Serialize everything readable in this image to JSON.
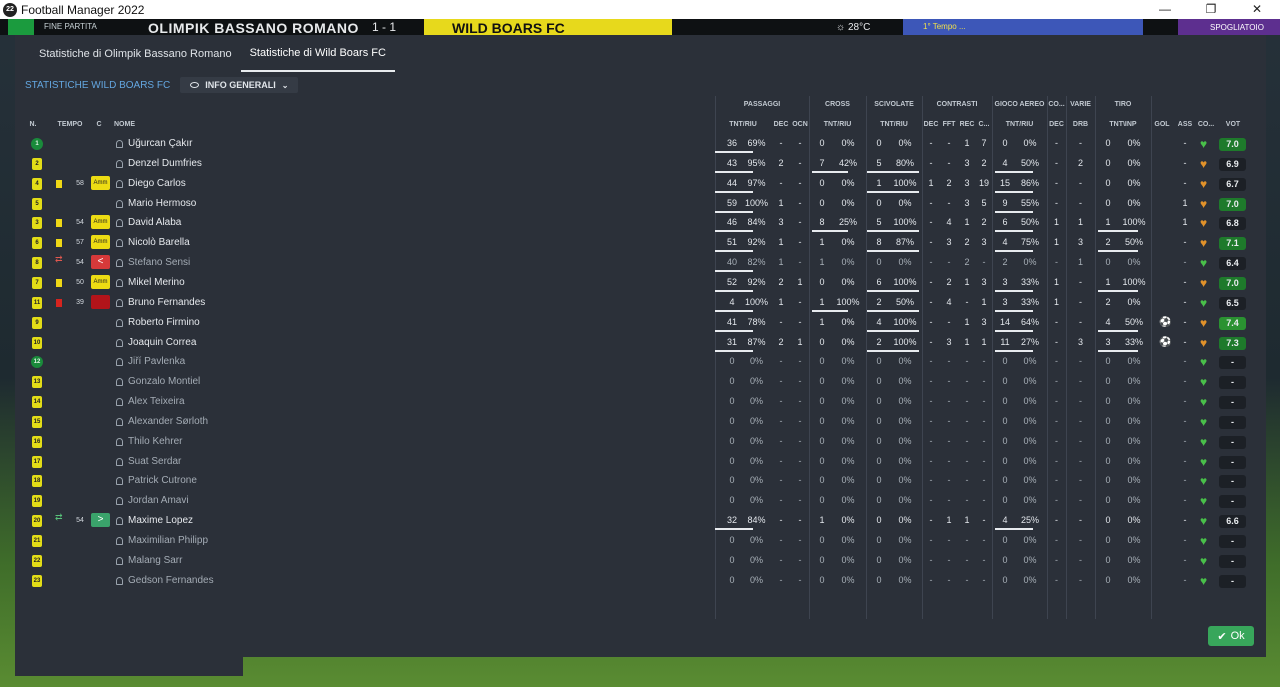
{
  "window": {
    "title": "Football Manager 2022",
    "app_badge": "22",
    "minimize": "—",
    "maximize": "❐",
    "close": "✕"
  },
  "topbar": {
    "status": "FINE PARTITA",
    "home_team": "OLIMPIK BASSANO ROMANO",
    "score": "1 - 1",
    "away_team": "WILD BOARS FC",
    "weather": "☼ 28°C",
    "sponsor": "1° Tempo ...",
    "continue": "SPOGLIATOIO"
  },
  "tabs": [
    {
      "label": "Statistiche di Olimpik Bassano Romano",
      "active": false
    },
    {
      "label": "Statistiche di Wild Boars FC",
      "active": true
    }
  ],
  "subheader": {
    "title": "STATISTICHE WILD BOARS FC",
    "dropdown": "INFO GENERALI"
  },
  "group_headers": {
    "passaggi": "PASSAGGI",
    "cross": "CROSS",
    "scivolate": "SCIVOLATE",
    "contrasti": "CONTRASTI",
    "gioco_aereo": "GIOCO AEREO",
    "co": "CO...",
    "varie": "VARIE",
    "tiro": "TIRO"
  },
  "columns": {
    "num": "N.",
    "tempo": "TEMPO",
    "c": "C",
    "nome": "NOME",
    "tnt_riu": "TNT/RIU",
    "dec": "DEC",
    "ocn": "OCN",
    "cross_tnt": "TNT/RIU",
    "sciv_tnt": "TNT/RIU",
    "c_dec": "DEC",
    "fft": "FFT",
    "rec": "REC",
    "c_more": "C...",
    "aereo_tnt": "TNT/RIU",
    "co_dec": "DEC",
    "drb": "DRB",
    "tiro_tnt": "TNT\\INP",
    "gol": "GOL",
    "ass": "ASS",
    "cond": "CO...",
    "vot": "VOT"
  },
  "players": [
    {
      "num": "1",
      "gk": true,
      "name": "Uğurcan Çakır",
      "pass": "36",
      "pass_pct": "69%",
      "dec": "-",
      "ocn": "-",
      "cross": "0",
      "cross_pct": "0%",
      "sciv": "0",
      "sciv_pct": "0%",
      "c_dec": "-",
      "fft": "-",
      "rec": "1",
      "cc": "7",
      "aer": "0",
      "aer_pct": "0%",
      "co_dec": "-",
      "drb": "-",
      "tiro": "0",
      "tiro_pct": "0%",
      "ass": "-",
      "vot": "7.0",
      "vot_style": "good",
      "heart": "green",
      "pass_ul": true
    },
    {
      "num": "2",
      "name": "Denzel Dumfries",
      "pass": "43",
      "pass_pct": "95%",
      "dec": "2",
      "ocn": "-",
      "cross": "7",
      "cross_pct": "42%",
      "sciv": "5",
      "sciv_pct": "80%",
      "c_dec": "-",
      "fft": "-",
      "rec": "3",
      "cc": "2",
      "aer": "4",
      "aer_pct": "50%",
      "co_dec": "-",
      "drb": "2",
      "tiro": "0",
      "tiro_pct": "0%",
      "ass": "-",
      "vot": "6.9",
      "heart": "orange",
      "pass_ul": true,
      "cross_ul": true,
      "sciv_ul": true,
      "aer_ul": true
    },
    {
      "num": "4",
      "tempo": "58",
      "card": "yellow",
      "cbadge": "Amm",
      "name": "Diego Carlos",
      "pass": "44",
      "pass_pct": "97%",
      "dec": "-",
      "ocn": "-",
      "cross": "0",
      "cross_pct": "0%",
      "sciv": "1",
      "sciv_pct": "100%",
      "c_dec": "1",
      "fft": "2",
      "rec": "3",
      "cc": "19",
      "aer": "15",
      "aer_pct": "86%",
      "co_dec": "-",
      "drb": "-",
      "tiro": "0",
      "tiro_pct": "0%",
      "ass": "-",
      "vot": "6.7",
      "heart": "orange",
      "pass_ul": true,
      "sciv_ul": true,
      "aer_ul": true
    },
    {
      "num": "5",
      "name": "Mario Hermoso",
      "pass": "59",
      "pass_pct": "100%",
      "dec": "1",
      "ocn": "-",
      "cross": "0",
      "cross_pct": "0%",
      "sciv": "0",
      "sciv_pct": "0%",
      "c_dec": "-",
      "fft": "-",
      "rec": "3",
      "cc": "5",
      "aer": "9",
      "aer_pct": "55%",
      "co_dec": "-",
      "drb": "-",
      "tiro": "0",
      "tiro_pct": "0%",
      "ass": "1",
      "vot": "7.0",
      "vot_style": "good",
      "heart": "orange",
      "pass_ul": true,
      "aer_ul": true
    },
    {
      "num": "3",
      "tempo": "54",
      "card": "yellow",
      "cbadge": "Amm",
      "name": "David Alaba",
      "pass": "46",
      "pass_pct": "84%",
      "dec": "3",
      "ocn": "-",
      "cross": "8",
      "cross_pct": "25%",
      "sciv": "5",
      "sciv_pct": "100%",
      "c_dec": "-",
      "fft": "4",
      "rec": "1",
      "cc": "2",
      "aer": "6",
      "aer_pct": "50%",
      "co_dec": "1",
      "drb": "1",
      "tiro": "1",
      "tiro_pct": "100%",
      "ass": "1",
      "vot": "6.8",
      "heart": "orange",
      "pass_ul": true,
      "cross_ul": true,
      "sciv_ul": true,
      "aer_ul": true,
      "tiro_ul": true
    },
    {
      "num": "6",
      "tempo": "57",
      "card": "yellow",
      "cbadge": "Amm",
      "name": "Nicolò Barella",
      "pass": "51",
      "pass_pct": "92%",
      "dec": "1",
      "ocn": "-",
      "cross": "1",
      "cross_pct": "0%",
      "sciv": "8",
      "sciv_pct": "87%",
      "c_dec": "-",
      "fft": "3",
      "rec": "2",
      "cc": "3",
      "aer": "4",
      "aer_pct": "75%",
      "co_dec": "1",
      "drb": "3",
      "tiro": "2",
      "tiro_pct": "50%",
      "ass": "-",
      "vot": "7.1",
      "vot_style": "good",
      "heart": "orange",
      "pass_ul": true,
      "sciv_ul": true,
      "aer_ul": true,
      "tiro_ul": true
    },
    {
      "num": "8",
      "tempo": "54",
      "sub": "out",
      "cbadge_type": "out",
      "cbadge_glyph": "<",
      "dim": true,
      "name": "Stefano Sensi",
      "pass": "40",
      "pass_pct": "82%",
      "dec": "1",
      "ocn": "-",
      "cross": "1",
      "cross_pct": "0%",
      "sciv": "0",
      "sciv_pct": "0%",
      "c_dec": "-",
      "fft": "-",
      "rec": "2",
      "cc": "-",
      "aer": "2",
      "aer_pct": "0%",
      "co_dec": "-",
      "drb": "1",
      "tiro": "0",
      "tiro_pct": "0%",
      "ass": "-",
      "vot": "6.4",
      "heart": "green",
      "pass_ul": true
    },
    {
      "num": "7",
      "tempo": "50",
      "card": "yellow",
      "cbadge": "Amm",
      "name": "Mikel Merino",
      "pass": "52",
      "pass_pct": "92%",
      "dec": "2",
      "ocn": "1",
      "cross": "0",
      "cross_pct": "0%",
      "sciv": "6",
      "sciv_pct": "100%",
      "c_dec": "-",
      "fft": "2",
      "rec": "1",
      "cc": "3",
      "aer": "3",
      "aer_pct": "33%",
      "co_dec": "1",
      "drb": "-",
      "tiro": "1",
      "tiro_pct": "100%",
      "ass": "-",
      "vot": "7.0",
      "vot_style": "good",
      "heart": "orange",
      "pass_ul": true,
      "sciv_ul": true,
      "aer_ul": true,
      "tiro_ul": true
    },
    {
      "num": "11",
      "tempo": "39",
      "card": "red",
      "cbadge_type": "esp",
      "name": "Bruno Fernandes",
      "pass": "4",
      "pass_pct": "100%",
      "dec": "1",
      "ocn": "-",
      "cross": "1",
      "cross_pct": "100%",
      "sciv": "2",
      "sciv_pct": "50%",
      "c_dec": "-",
      "fft": "4",
      "rec": "-",
      "cc": "1",
      "aer": "3",
      "aer_pct": "33%",
      "co_dec": "1",
      "drb": "-",
      "tiro": "2",
      "tiro_pct": "0%",
      "ass": "-",
      "vot": "6.5",
      "heart": "green",
      "pass_ul": true,
      "cross_ul": true,
      "sciv_ul": true,
      "aer_ul": true
    },
    {
      "num": "9",
      "name": "Roberto Firmino",
      "pass": "41",
      "pass_pct": "78%",
      "dec": "-",
      "ocn": "-",
      "cross": "1",
      "cross_pct": "0%",
      "sciv": "4",
      "sciv_pct": "100%",
      "c_dec": "-",
      "fft": "-",
      "rec": "1",
      "cc": "3",
      "aer": "14",
      "aer_pct": "64%",
      "co_dec": "-",
      "drb": "-",
      "tiro": "4",
      "tiro_pct": "50%",
      "gol": "⚽",
      "ass": "-",
      "vot": "7.4",
      "vot_style": "green",
      "heart": "orange",
      "pass_ul": true,
      "sciv_ul": true,
      "aer_ul": true,
      "tiro_ul": true
    },
    {
      "num": "10",
      "name": "Joaquin Correa",
      "pass": "31",
      "pass_pct": "87%",
      "dec": "2",
      "ocn": "1",
      "cross": "0",
      "cross_pct": "0%",
      "sciv": "2",
      "sciv_pct": "100%",
      "c_dec": "-",
      "fft": "3",
      "rec": "1",
      "cc": "1",
      "aer": "11",
      "aer_pct": "27%",
      "co_dec": "-",
      "drb": "3",
      "tiro": "3",
      "tiro_pct": "33%",
      "gol": "⚽",
      "ass": "-",
      "vot": "7.3",
      "vot_style": "good",
      "heart": "orange",
      "pass_ul": true,
      "sciv_ul": true,
      "aer_ul": true,
      "tiro_ul": true
    },
    {
      "num": "12",
      "gk": true,
      "dim": true,
      "name": "Jiří Pavlenka",
      "pass": "0",
      "pass_pct": "0%",
      "dec": "-",
      "ocn": "-",
      "cross": "0",
      "cross_pct": "0%",
      "sciv": "0",
      "sciv_pct": "0%",
      "c_dec": "-",
      "fft": "-",
      "rec": "-",
      "cc": "-",
      "aer": "0",
      "aer_pct": "0%",
      "co_dec": "-",
      "drb": "-",
      "tiro": "0",
      "tiro_pct": "0%",
      "ass": "-",
      "vot": "-",
      "heart": "green"
    },
    {
      "num": "13",
      "dim": true,
      "name": "Gonzalo Montiel",
      "pass": "0",
      "pass_pct": "0%",
      "dec": "-",
      "ocn": "-",
      "cross": "0",
      "cross_pct": "0%",
      "sciv": "0",
      "sciv_pct": "0%",
      "c_dec": "-",
      "fft": "-",
      "rec": "-",
      "cc": "-",
      "aer": "0",
      "aer_pct": "0%",
      "co_dec": "-",
      "drb": "-",
      "tiro": "0",
      "tiro_pct": "0%",
      "ass": "-",
      "vot": "-",
      "heart": "green"
    },
    {
      "num": "14",
      "dim": true,
      "name": "Alex Teixeira",
      "pass": "0",
      "pass_pct": "0%",
      "dec": "-",
      "ocn": "-",
      "cross": "0",
      "cross_pct": "0%",
      "sciv": "0",
      "sciv_pct": "0%",
      "c_dec": "-",
      "fft": "-",
      "rec": "-",
      "cc": "-",
      "aer": "0",
      "aer_pct": "0%",
      "co_dec": "-",
      "drb": "-",
      "tiro": "0",
      "tiro_pct": "0%",
      "ass": "-",
      "vot": "-",
      "heart": "green"
    },
    {
      "num": "15",
      "dim": true,
      "name": "Alexander Sørloth",
      "pass": "0",
      "pass_pct": "0%",
      "dec": "-",
      "ocn": "-",
      "cross": "0",
      "cross_pct": "0%",
      "sciv": "0",
      "sciv_pct": "0%",
      "c_dec": "-",
      "fft": "-",
      "rec": "-",
      "cc": "-",
      "aer": "0",
      "aer_pct": "0%",
      "co_dec": "-",
      "drb": "-",
      "tiro": "0",
      "tiro_pct": "0%",
      "ass": "-",
      "vot": "-",
      "heart": "green"
    },
    {
      "num": "16",
      "dim": true,
      "name": "Thilo Kehrer",
      "pass": "0",
      "pass_pct": "0%",
      "dec": "-",
      "ocn": "-",
      "cross": "0",
      "cross_pct": "0%",
      "sciv": "0",
      "sciv_pct": "0%",
      "c_dec": "-",
      "fft": "-",
      "rec": "-",
      "cc": "-",
      "aer": "0",
      "aer_pct": "0%",
      "co_dec": "-",
      "drb": "-",
      "tiro": "0",
      "tiro_pct": "0%",
      "ass": "-",
      "vot": "-",
      "heart": "green"
    },
    {
      "num": "17",
      "dim": true,
      "name": "Suat Serdar",
      "pass": "0",
      "pass_pct": "0%",
      "dec": "-",
      "ocn": "-",
      "cross": "0",
      "cross_pct": "0%",
      "sciv": "0",
      "sciv_pct": "0%",
      "c_dec": "-",
      "fft": "-",
      "rec": "-",
      "cc": "-",
      "aer": "0",
      "aer_pct": "0%",
      "co_dec": "-",
      "drb": "-",
      "tiro": "0",
      "tiro_pct": "0%",
      "ass": "-",
      "vot": "-",
      "heart": "green"
    },
    {
      "num": "18",
      "dim": true,
      "name": "Patrick Cutrone",
      "pass": "0",
      "pass_pct": "0%",
      "dec": "-",
      "ocn": "-",
      "cross": "0",
      "cross_pct": "0%",
      "sciv": "0",
      "sciv_pct": "0%",
      "c_dec": "-",
      "fft": "-",
      "rec": "-",
      "cc": "-",
      "aer": "0",
      "aer_pct": "0%",
      "co_dec": "-",
      "drb": "-",
      "tiro": "0",
      "tiro_pct": "0%",
      "ass": "-",
      "vot": "-",
      "heart": "green"
    },
    {
      "num": "19",
      "dim": true,
      "name": "Jordan Amavi",
      "pass": "0",
      "pass_pct": "0%",
      "dec": "-",
      "ocn": "-",
      "cross": "0",
      "cross_pct": "0%",
      "sciv": "0",
      "sciv_pct": "0%",
      "c_dec": "-",
      "fft": "-",
      "rec": "-",
      "cc": "-",
      "aer": "0",
      "aer_pct": "0%",
      "co_dec": "-",
      "drb": "-",
      "tiro": "0",
      "tiro_pct": "0%",
      "ass": "-",
      "vot": "-",
      "heart": "green"
    },
    {
      "num": "20",
      "tempo": "54",
      "sub": "in",
      "cbadge_type": "in",
      "cbadge_glyph": ">",
      "name": "Maxime Lopez",
      "pass": "32",
      "pass_pct": "84%",
      "dec": "-",
      "ocn": "-",
      "cross": "1",
      "cross_pct": "0%",
      "sciv": "0",
      "sciv_pct": "0%",
      "c_dec": "-",
      "fft": "1",
      "rec": "1",
      "cc": "-",
      "aer": "4",
      "aer_pct": "25%",
      "co_dec": "-",
      "drb": "-",
      "tiro": "0",
      "tiro_pct": "0%",
      "ass": "-",
      "vot": "6.6",
      "heart": "green",
      "pass_ul": true,
      "aer_ul": true
    },
    {
      "num": "21",
      "dim": true,
      "name": "Maximilian Philipp",
      "pass": "0",
      "pass_pct": "0%",
      "dec": "-",
      "ocn": "-",
      "cross": "0",
      "cross_pct": "0%",
      "sciv": "0",
      "sciv_pct": "0%",
      "c_dec": "-",
      "fft": "-",
      "rec": "-",
      "cc": "-",
      "aer": "0",
      "aer_pct": "0%",
      "co_dec": "-",
      "drb": "-",
      "tiro": "0",
      "tiro_pct": "0%",
      "ass": "-",
      "vot": "-",
      "heart": "green"
    },
    {
      "num": "22",
      "dim": true,
      "name": "Malang Sarr",
      "pass": "0",
      "pass_pct": "0%",
      "dec": "-",
      "ocn": "-",
      "cross": "0",
      "cross_pct": "0%",
      "sciv": "0",
      "sciv_pct": "0%",
      "c_dec": "-",
      "fft": "-",
      "rec": "-",
      "cc": "-",
      "aer": "0",
      "aer_pct": "0%",
      "co_dec": "-",
      "drb": "-",
      "tiro": "0",
      "tiro_pct": "0%",
      "ass": "-",
      "vot": "-",
      "heart": "green"
    },
    {
      "num": "23",
      "dim": true,
      "name": "Gedson Fernandes",
      "pass": "0",
      "pass_pct": "0%",
      "dec": "-",
      "ocn": "-",
      "cross": "0",
      "cross_pct": "0%",
      "sciv": "0",
      "sciv_pct": "0%",
      "c_dec": "-",
      "fft": "-",
      "rec": "-",
      "cc": "-",
      "aer": "0",
      "aer_pct": "0%",
      "co_dec": "-",
      "drb": "-",
      "tiro": "0",
      "tiro_pct": "0%",
      "ass": "-",
      "vot": "-",
      "heart": "green"
    }
  ],
  "ok_button": {
    "label": "Ok"
  },
  "colors": {
    "accent_blue": "#63a6e0",
    "heart_green": "#49c04a",
    "heart_orange": "#e0912a",
    "ok_green": "#38a65b"
  }
}
